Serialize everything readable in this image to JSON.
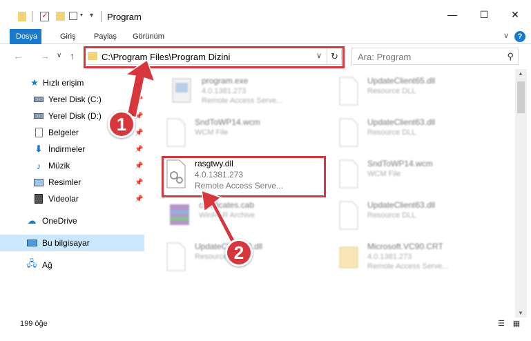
{
  "window": {
    "title": "Program",
    "minimize_symbol": "—",
    "maximize_symbol": "☐",
    "close_symbol": "✕"
  },
  "ribbon": {
    "tabs": [
      "Dosya",
      "Giriş",
      "Paylaş",
      "Görünüm"
    ],
    "help_symbol": "?",
    "collapse_symbol": "∨"
  },
  "address": {
    "path": "C:\\Program Files\\Program Dizini",
    "dropdown_symbol": "∨",
    "refresh_symbol": "↻"
  },
  "nav_buttons": {
    "back": "←",
    "forward": "→",
    "recent": "∨",
    "up": "↑"
  },
  "search": {
    "placeholder": "Ara: Program",
    "icon": "search-icon"
  },
  "sidebar": {
    "items": [
      {
        "label": "Hızlı erişim",
        "icon": "star-icon",
        "pinned": false
      },
      {
        "label": "Yerel Disk (C:)",
        "icon": "drive-icon",
        "pinned": true
      },
      {
        "label": "Yerel Disk (D:)",
        "icon": "drive-icon",
        "pinned": true
      },
      {
        "label": "Belgeler",
        "icon": "document-icon",
        "pinned": true
      },
      {
        "label": "İndirmeler",
        "icon": "download-icon",
        "pinned": true
      },
      {
        "label": "Müzik",
        "icon": "music-icon",
        "pinned": true
      },
      {
        "label": "Resimler",
        "icon": "pictures-icon",
        "pinned": true
      },
      {
        "label": "Videolar",
        "icon": "video-icon",
        "pinned": true
      },
      {
        "label": "OneDrive",
        "icon": "cloud-icon",
        "pinned": false
      },
      {
        "label": "Bu bilgisayar",
        "icon": "computer-icon",
        "pinned": false
      },
      {
        "label": "Ağ",
        "icon": "network-icon",
        "pinned": false
      }
    ]
  },
  "files": {
    "left": [
      {
        "name": "program.exe",
        "line1": "4.0.1381.273",
        "line2": "Remote Access Serve...",
        "icon": "exe-icon"
      },
      {
        "name": "SndToWP14.wcm",
        "line1": "WCM File",
        "line2": "",
        "icon": "file-icon"
      },
      {
        "name": "rasgtwy.dll",
        "line1": "4.0.1381.273",
        "line2": "Remote Access Serve...",
        "icon": "dll-icon"
      },
      {
        "name": "certificates.cab",
        "line1": "WinRAR Archive",
        "line2": "",
        "icon": "archive-icon"
      },
      {
        "name": "UpdateClient63.dll",
        "line1": "Resource DLL",
        "line2": "",
        "icon": "dll-icon"
      }
    ],
    "right": [
      {
        "name": "UpdateClient65.dll",
        "line1": "Resource DLL",
        "line2": "",
        "icon": "dll-icon"
      },
      {
        "name": "UpdateClient63.dll",
        "line1": "Resource DLL",
        "line2": "",
        "icon": "dll-icon"
      },
      {
        "name": "SndToWP14.wcm",
        "line1": "WCM File",
        "line2": "",
        "icon": "file-icon"
      },
      {
        "name": "UpdateClient63.dll",
        "line1": "Resource DLL",
        "line2": "",
        "icon": "dll-icon"
      },
      {
        "name": "Microsoft.VC90.CRT",
        "line1": "4.0.1381.273",
        "line2": "Remote Access Serve...",
        "icon": "folder-icon"
      }
    ]
  },
  "status": {
    "count": "199 öğe"
  },
  "callouts": [
    "1",
    "2"
  ],
  "colors": {
    "accent": "#1979ca",
    "highlight": "#d7363d",
    "selection": "#cce8ff"
  }
}
